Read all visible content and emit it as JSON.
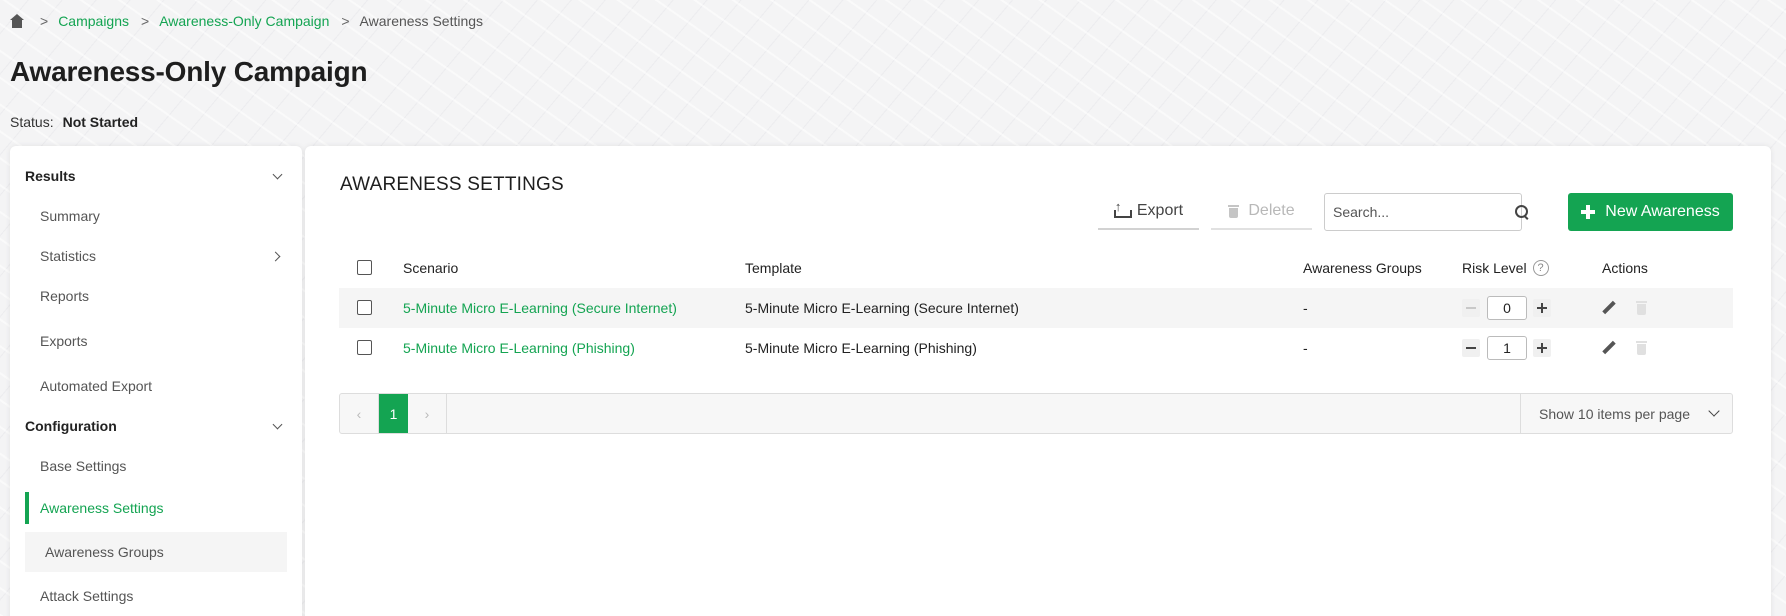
{
  "breadcrumb": {
    "home_icon": "home-icon",
    "items": [
      "Campaigns",
      "Awareness-Only Campaign"
    ],
    "current": "Awareness Settings"
  },
  "page": {
    "title": "Awareness-Only Campaign",
    "status_label": "Status:",
    "status_value": "Not Started"
  },
  "sidebar": {
    "results_label": "Results",
    "results_items": [
      "Summary",
      "Statistics",
      "Reports",
      "Exports",
      "Automated Export"
    ],
    "configuration_label": "Configuration",
    "configuration_items": [
      "Base Settings",
      "Awareness Settings",
      "Awareness Groups",
      "Attack Settings"
    ],
    "active_item": "Awareness Settings"
  },
  "main": {
    "title": "AWARENESS SETTINGS",
    "export_label": "Export",
    "delete_label": "Delete",
    "search_placeholder": "Search...",
    "new_label": "New Awareness",
    "accent_color": "#14a452"
  },
  "table": {
    "columns": {
      "scenario": "Scenario",
      "template": "Template",
      "groups": "Awareness Groups",
      "risk": "Risk Level",
      "actions": "Actions"
    },
    "rows": [
      {
        "scenario": "5-Minute Micro E-Learning (Secure Internet)",
        "template": "5-Minute Micro E-Learning (Secure Internet)",
        "groups": "-",
        "risk": "0"
      },
      {
        "scenario": "5-Minute Micro E-Learning (Phishing)",
        "template": "5-Minute Micro E-Learning (Phishing)",
        "groups": "-",
        "risk": "1"
      }
    ]
  },
  "pagination": {
    "prev": "‹",
    "current_page": "1",
    "next": "›",
    "per_page": "Show 10 items per page"
  }
}
